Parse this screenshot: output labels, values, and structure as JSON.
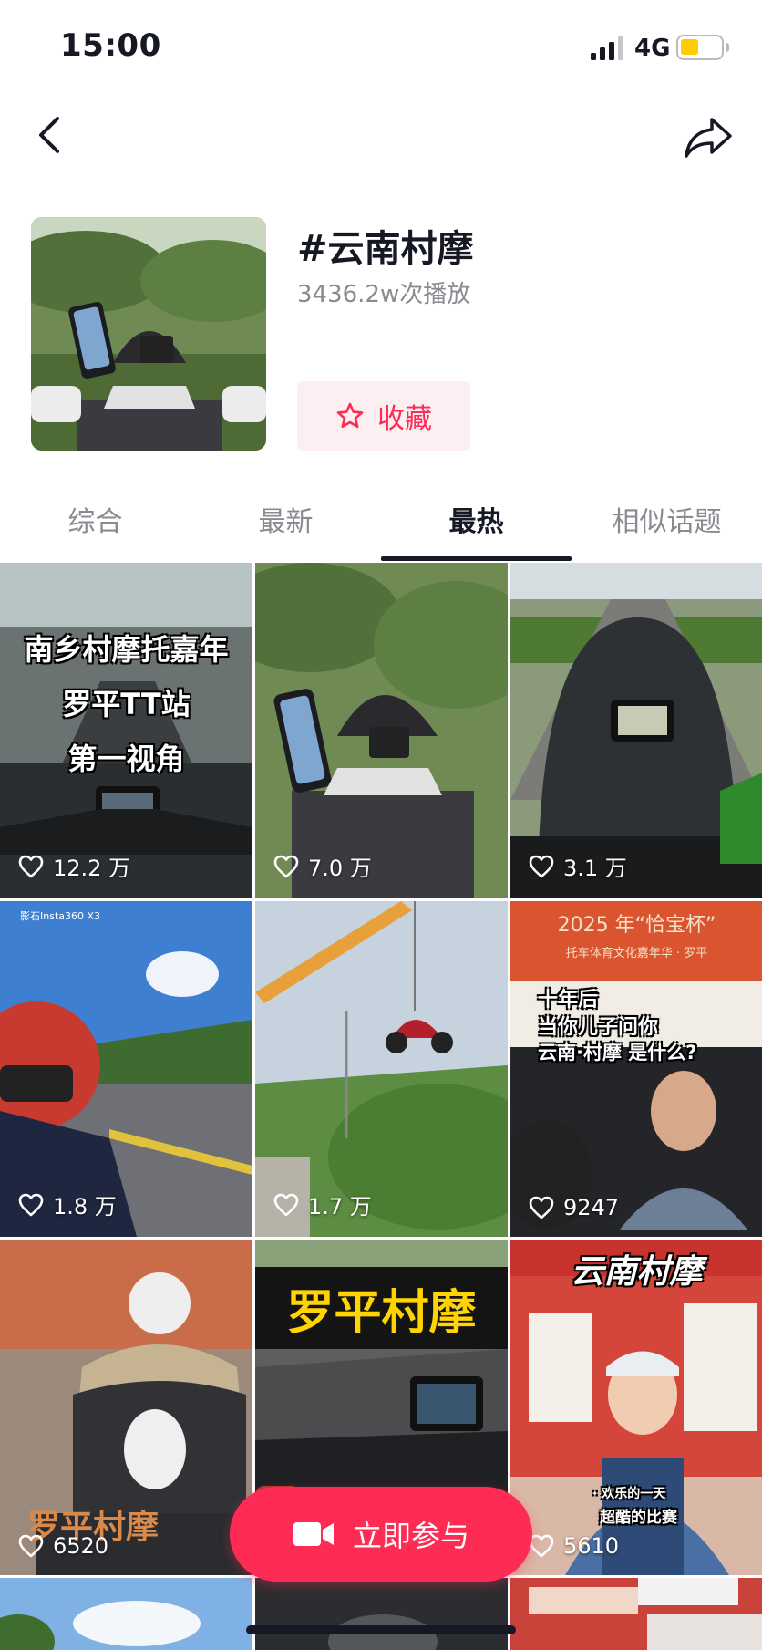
{
  "status_bar": {
    "time": "15:00",
    "network": "4G",
    "battery_level": 0.45,
    "battery_color": "#ffcc00"
  },
  "nav": {
    "back_icon": "chevron-left-icon",
    "share_icon": "share-arrow-icon"
  },
  "topic": {
    "title": "#云南村摩",
    "play_count": "3436.2w次播放",
    "favorite_label": "收藏"
  },
  "tabs": [
    {
      "label": "综合",
      "active": false
    },
    {
      "label": "最新",
      "active": false
    },
    {
      "label": "最热",
      "active": true
    },
    {
      "label": "相似话题",
      "active": false
    }
  ],
  "videos": [
    {
      "overlay": [
        "南乡村摩托嘉年",
        "罗平TT站",
        "第一视角"
      ],
      "likes": "12.2 万"
    },
    {
      "overlay": [],
      "likes": "7.0 万"
    },
    {
      "overlay": [],
      "likes": "3.1 万"
    },
    {
      "overlay": [
        "影石Insta360 X3"
      ],
      "likes": "1.8 万"
    },
    {
      "overlay": [],
      "likes": "1.7 万"
    },
    {
      "overlay": [
        "2025 年“恰宝杯”",
        "托车体育文化嘉年华 · 罗平",
        "十年后",
        "当你儿子问你",
        "云南·村摩 是什么?"
      ],
      "likes": "9247"
    },
    {
      "overlay": [
        "罗平村摩"
      ],
      "likes": "6520"
    },
    {
      "overlay": [
        "罗平村摩"
      ],
      "likes": ""
    },
    {
      "overlay": [
        "云南村摩",
        "· 欢乐的一天",
        "超酷的比赛"
      ],
      "likes": "5610"
    }
  ],
  "join_button": {
    "label": "立即参与",
    "icon": "video-camera-icon"
  },
  "colors": {
    "accent": "#fe2c55",
    "favorite_bg": "#fdeff1",
    "text_primary": "#161823",
    "text_secondary": "#8a8b91"
  }
}
